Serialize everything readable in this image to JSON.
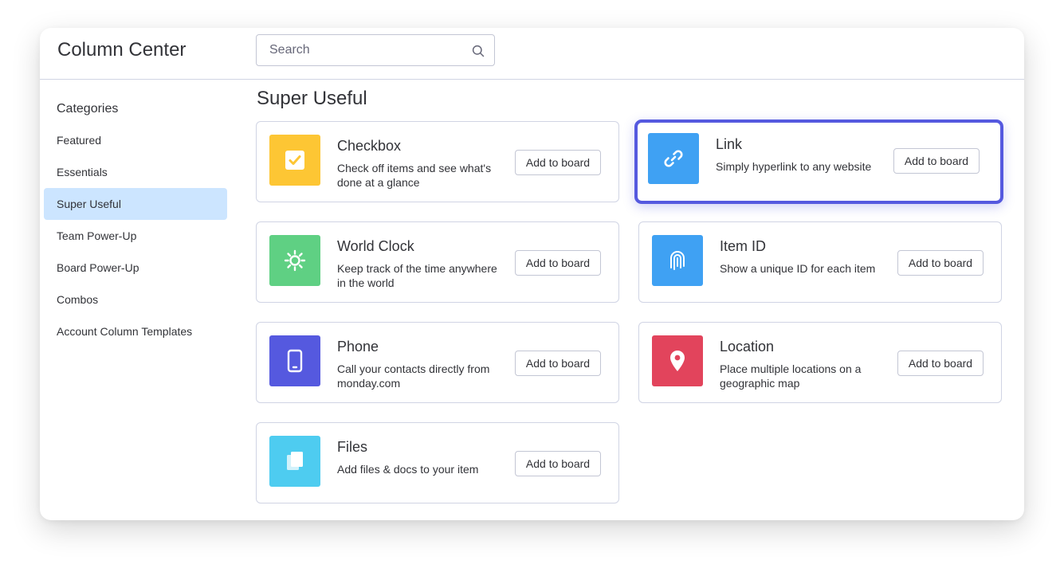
{
  "header": {
    "title": "Column Center",
    "search_placeholder": "Search",
    "search_value": ""
  },
  "sidebar": {
    "heading": "Categories",
    "items": [
      {
        "label": "Featured",
        "active": false
      },
      {
        "label": "Essentials",
        "active": false
      },
      {
        "label": "Super Useful",
        "active": true
      },
      {
        "label": "Team Power-Up",
        "active": false
      },
      {
        "label": "Board Power-Up",
        "active": false
      },
      {
        "label": "Combos",
        "active": false
      },
      {
        "label": "Account Column Templates",
        "active": false
      }
    ]
  },
  "main": {
    "section_title": "Super Useful",
    "add_label": "Add to board",
    "columns": [
      {
        "name": "Checkbox",
        "description": "Check off items and see what's done at a glance",
        "icon": "checkbox-icon",
        "color": "#fdc634",
        "selected": false
      },
      {
        "name": "Link",
        "description": "Simply hyperlink to any website",
        "icon": "link-icon",
        "color": "#3fa1f3",
        "selected": true
      },
      {
        "name": "World Clock",
        "description": "Keep track of the time anywhere in the world",
        "icon": "sun-icon",
        "color": "#5fd083",
        "selected": false
      },
      {
        "name": "Item ID",
        "description": "Show a unique ID for each item",
        "icon": "fingerprint-icon",
        "color": "#3fa1f3",
        "selected": false
      },
      {
        "name": "Phone",
        "description": "Call your contacts directly from monday.com",
        "icon": "phone-icon",
        "color": "#5559df",
        "selected": false
      },
      {
        "name": "Location",
        "description": "Place multiple locations on a geographic map",
        "icon": "map-pin-icon",
        "color": "#e2445c",
        "selected": false
      },
      {
        "name": "Files",
        "description": "Add files & docs to your item",
        "icon": "files-icon",
        "color": "#4eccf0",
        "selected": false
      }
    ]
  },
  "colors": {
    "selected_border": "#5559df",
    "active_category_bg": "#cce5ff"
  }
}
